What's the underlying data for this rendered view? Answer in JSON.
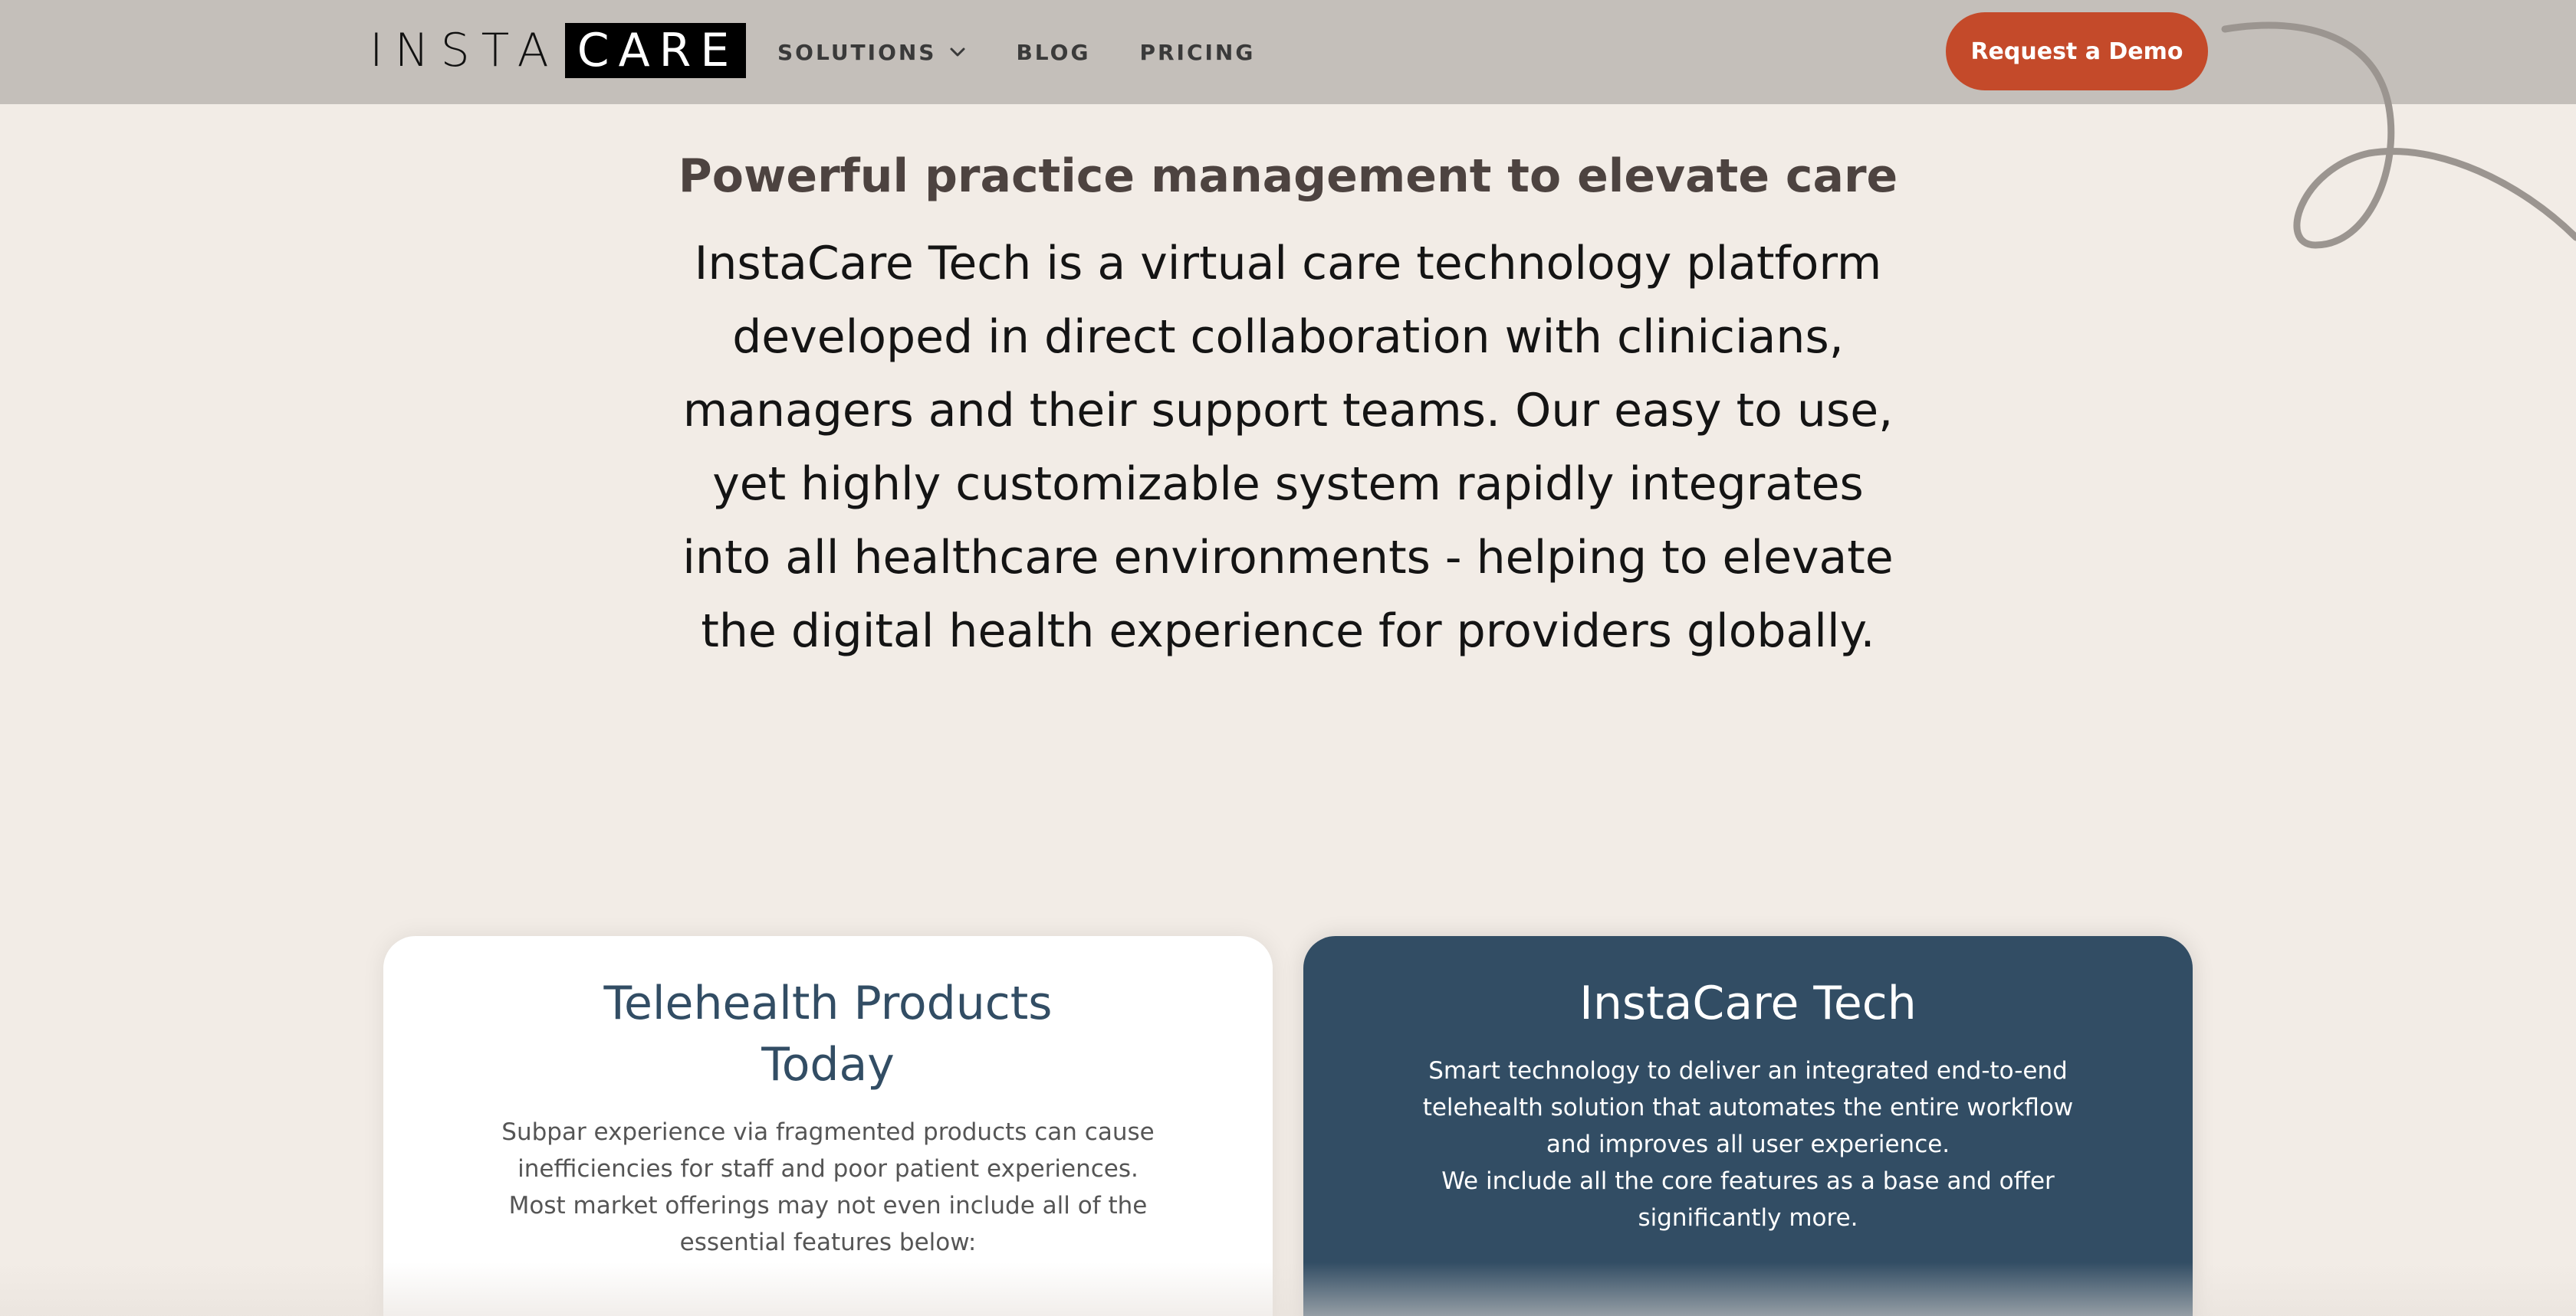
{
  "header": {
    "logo_left": "INSTA",
    "logo_right": "CARE",
    "nav": [
      {
        "label": "SOLUTIONS",
        "has_dropdown": true
      },
      {
        "label": "BLOG"
      },
      {
        "label": "PRICING"
      }
    ],
    "cta_label": "Request a Demo"
  },
  "hero": {
    "subtitle": "Powerful practice management to elevate care",
    "intro": "InstaCare Tech is a virtual care technology platform developed in direct collaboration with clinicians, managers and their support teams. Our easy to use, yet highly customizable system rapidly integrates into all healthcare environments - helping to elevate the digital health experience for providers globally."
  },
  "cards": {
    "left": {
      "title": "Telehealth Products Today",
      "text": "Subpar experience via fragmented products can cause inefficiencies for staff and poor patient experiences. Most market offerings may not even include all of the essential features below:"
    },
    "right": {
      "title": "InstaCare Tech",
      "text_1": "Smart technology to deliver an integrated end-to-end telehealth solution that automates the entire workflow and improves all user experience.",
      "text_2": "We include all the core features as a base and offer significantly more."
    }
  },
  "colors": {
    "header_bg": "#c4bfba",
    "page_bg": "#f2ece6",
    "cta": "#c44a2a",
    "navy": "#324d64"
  }
}
